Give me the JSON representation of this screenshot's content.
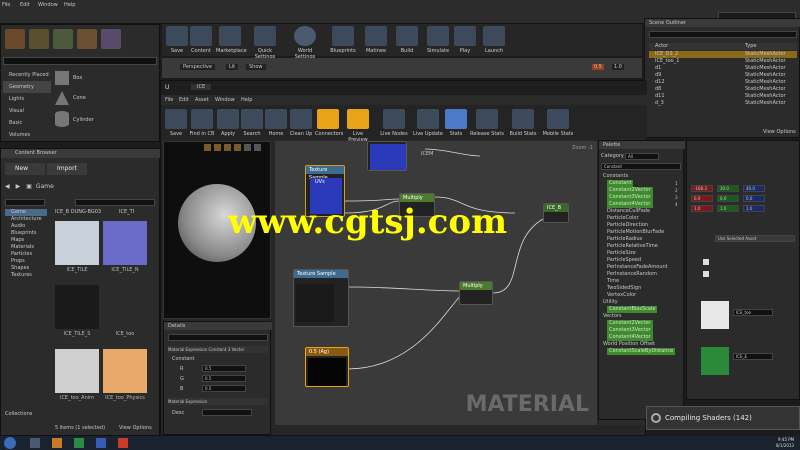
{
  "menus": {
    "top": [
      "File",
      "Edit",
      "Window",
      "Help"
    ],
    "material": [
      "File",
      "Edit",
      "Asset",
      "Window",
      "Help"
    ]
  },
  "main_toolbar": [
    "Save",
    "Content",
    "Marketplace",
    "Quick Settings",
    "World Settings",
    "Blueprints",
    "Matinee",
    "Build",
    "Simulate",
    "Play",
    "Launch"
  ],
  "material_toolbar": [
    "Save",
    "Find in CB",
    "Apply",
    "Search",
    "Home",
    "Clean Up",
    "Connectors",
    "Live Preview",
    "Live Nodes",
    "Live Update",
    "Stats",
    "Release Stats",
    "Build Stats",
    "Mobile Stats"
  ],
  "modes": {
    "items": [
      "Recently Placed",
      "Geometry",
      "Lights",
      "Visual",
      "Basic",
      "Volumes"
    ],
    "shapes": [
      "Box",
      "Cone",
      "Cylinder"
    ],
    "search_placeholder": "Search Classes"
  },
  "content_browser": {
    "title": "Content Browser",
    "new": "New",
    "import": "Import",
    "folder": "Game",
    "search": "Search Assets",
    "tree": [
      "Game",
      "Architecture",
      "Audio",
      "Blueprints",
      "Maps",
      "Materials",
      "Particles",
      "Props",
      "Shapes",
      "Textures"
    ],
    "path": "ICE_B OUNG-BG03",
    "path2": "ICE_TI",
    "assets": [
      "ICE_TILE",
      "ICE_TILE_N",
      "ICE_TILE_S",
      "ICE_too",
      "ICE_too_Anim",
      "ICE_too_Physics"
    ],
    "status": "5 items (1 selected)",
    "view_options": "View Options",
    "collections": "Collections"
  },
  "material": {
    "tab": "ICE",
    "graph_label": "MATERIAL",
    "zoom": "Zoom -1",
    "nodes": {
      "tex1": "Texture Sample",
      "tex2": "Texture Sample",
      "mult1": "Multiply",
      "mult2": "Multiply",
      "lerp": "ICE_B",
      "uvs": "UVs",
      "icem": "ICEM",
      "const": "0.5 (Ag)"
    }
  },
  "details": {
    "title": "Details",
    "search": "Search",
    "section": "Material Expression Constant 3 Vector",
    "constant": "Constant",
    "r": "0.5",
    "g": "0.5",
    "b": "0.5",
    "section2": "Material Expression",
    "desc": "Desc"
  },
  "palette": {
    "title": "Palette",
    "category": "Category",
    "all": "All",
    "search": "Constant",
    "groups": [
      "Constants",
      "Utility",
      "Vectors",
      "World Position Offset"
    ],
    "items": [
      "Constant",
      "Constant2Vector",
      "Constant3Vector",
      "Constant4Vector",
      "DistanceCullFade",
      "ParticleColor",
      "ParticleDirection",
      "ParticleMotionBlurFade",
      "ParticleRadius",
      "ParticleRelativeTime",
      "ParticleSize",
      "ParticleSpeed",
      "PerInstanceFadeAmount",
      "PerInstanceRandom",
      "Time",
      "TwoSidedSign",
      "VertexColor",
      "ConstantBiasScale",
      "Constant2Vector",
      "Constant3Vector",
      "Constant4Vector",
      "ConstantScaleByDistance"
    ],
    "counts": [
      "1",
      "2",
      "3",
      "4"
    ]
  },
  "outliner": {
    "title": "Scene Outliner",
    "search": "Search",
    "col_label": "Actor",
    "col_type": "Type",
    "rows": [
      "ICE_D3_2",
      "ICE_too_1",
      "d1",
      "d9",
      "d12",
      "d8",
      "d11",
      "d_3"
    ],
    "types": [
      "StaticMeshActor",
      "StaticMeshActor",
      "StaticMeshActor",
      "StaticMeshActor",
      "StaticMeshActor",
      "StaticMeshActor",
      "StaticMeshActor",
      "StaticMeshActor"
    ],
    "view_options": "View Options"
  },
  "right_details": {
    "values": [
      "-168.3",
      "30.0",
      "40.0",
      "0.0",
      "0.0",
      "0.0",
      "1.0",
      "1.0",
      "1.0"
    ],
    "mat1": "ICE_too",
    "mat2": "ICE_E",
    "browse": "Use Selected Asset"
  },
  "viewport": {
    "perspective": "Perspective",
    "lit": "Lit",
    "show": "Show",
    "coords": "0.5",
    "lighting": "1.0"
  },
  "watermark": "www.cgtsj.com",
  "notification": "Compiling Shaders (142)",
  "taskbar": {
    "time": "9:45 PM",
    "date": "8/1/2013"
  },
  "colors": {
    "accent": "#e8a317",
    "selected_node": "#e8a317",
    "blue_tex": "#2a3ab8"
  }
}
